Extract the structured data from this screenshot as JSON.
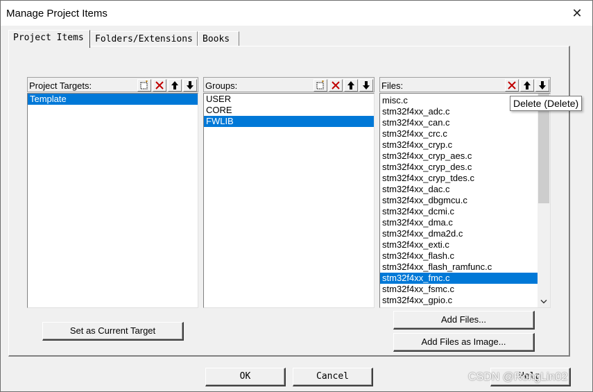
{
  "window": {
    "title": "Manage Project Items",
    "close_glyph": "✕"
  },
  "tabs": [
    {
      "label": "Project Items"
    },
    {
      "label": "Folders/Extensions"
    },
    {
      "label": "Books"
    }
  ],
  "targets": {
    "label": "Project Targets:",
    "items": [
      "Template"
    ],
    "selected_index": 0
  },
  "groups": {
    "label": "Groups:",
    "items": [
      "USER",
      "CORE",
      "FWLIB"
    ],
    "selected_index": 2
  },
  "files": {
    "label": "Files:",
    "items": [
      "misc.c",
      "stm32f4xx_adc.c",
      "stm32f4xx_can.c",
      "stm32f4xx_crc.c",
      "stm32f4xx_cryp.c",
      "stm32f4xx_cryp_aes.c",
      "stm32f4xx_cryp_des.c",
      "stm32f4xx_cryp_tdes.c",
      "stm32f4xx_dac.c",
      "stm32f4xx_dbgmcu.c",
      "stm32f4xx_dcmi.c",
      "stm32f4xx_dma.c",
      "stm32f4xx_dma2d.c",
      "stm32f4xx_exti.c",
      "stm32f4xx_flash.c",
      "stm32f4xx_flash_ramfunc.c",
      "stm32f4xx_fmc.c",
      "stm32f4xx_fsmc.c",
      "stm32f4xx_gpio.c"
    ],
    "selected_index": 16,
    "scroll_position": 0
  },
  "buttons": {
    "set_current_target": "Set as Current Target",
    "add_files": "Add Files...",
    "add_files_as_image": "Add Files as Image...",
    "ok": "OK",
    "cancel": "Cancel",
    "help": "Help"
  },
  "tooltip": "Delete (Delete)",
  "watermark": "CSDN @RongLin02",
  "colors": {
    "selection": "#0078d7",
    "delete_icon": "#c00000"
  }
}
